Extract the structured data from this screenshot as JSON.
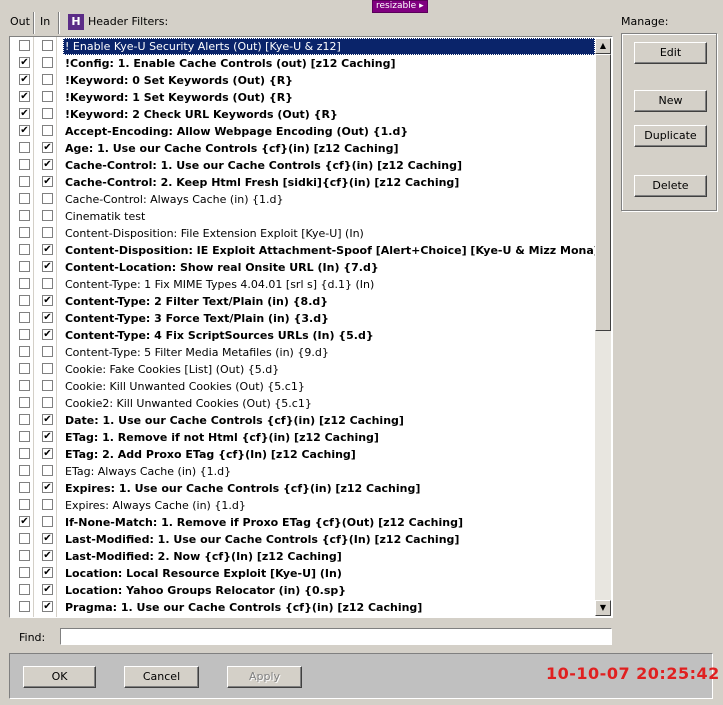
{
  "resizable_label": "resizable",
  "columns": {
    "out": "Out",
    "in": "In"
  },
  "header_icon": "H",
  "header_filters_label": "Header Filters:",
  "manage_label": "Manage:",
  "buttons": {
    "edit": "Edit",
    "new": "New",
    "duplicate": "Duplicate",
    "delete": "Delete"
  },
  "find_label": "Find:",
  "find_value": "",
  "dialog": {
    "ok": "OK",
    "cancel": "Cancel",
    "apply": "Apply"
  },
  "timestamp": "10-10-07 20:25:42",
  "colors": {
    "selection": "#0a246a",
    "timestamp": "#e02020",
    "badge": "#800080"
  },
  "filters": [
    {
      "out": false,
      "in": false,
      "bold": false,
      "selected": true,
      "label": "! Enable Kye-U Security Alerts (Out) [Kye-U & z12]"
    },
    {
      "out": true,
      "in": false,
      "bold": true,
      "label": "!Config: 1. Enable Cache Controls (out) [z12 Caching]"
    },
    {
      "out": true,
      "in": false,
      "bold": true,
      "label": "!Keyword: 0 Set Keywords (Out) {R}"
    },
    {
      "out": true,
      "in": false,
      "bold": true,
      "label": "!Keyword: 1 Set Keywords (Out) {R}"
    },
    {
      "out": true,
      "in": false,
      "bold": true,
      "label": "!Keyword: 2 Check URL Keywords (Out) {R}"
    },
    {
      "out": true,
      "in": false,
      "bold": true,
      "label": "Accept-Encoding: Allow Webpage Encoding (Out) {1.d}"
    },
    {
      "out": false,
      "in": true,
      "bold": true,
      "label": "Age: 1. Use our Cache Controls {cf}(in) [z12 Caching]"
    },
    {
      "out": false,
      "in": true,
      "bold": true,
      "label": "Cache-Control: 1. Use our Cache Controls {cf}(in) [z12 Caching]"
    },
    {
      "out": false,
      "in": true,
      "bold": true,
      "label": "Cache-Control: 2. Keep Html Fresh [sidki]{cf}(in) [z12 Caching]"
    },
    {
      "out": false,
      "in": false,
      "bold": false,
      "label": "Cache-Control: Always Cache (in) {1.d}"
    },
    {
      "out": false,
      "in": false,
      "bold": false,
      "label": "Cinematik test"
    },
    {
      "out": false,
      "in": false,
      "bold": false,
      "label": "Content-Disposition: File Extension Exploit [Kye-U] (In)"
    },
    {
      "out": false,
      "in": true,
      "bold": true,
      "label": "Content-Disposition: IE Exploit Attachment-Spoof [Alert+Choice] [Kye-U & Mizz Mona] (In)"
    },
    {
      "out": false,
      "in": true,
      "bold": true,
      "label": "Content-Location: Show real Onsite URL (In) {7.d}"
    },
    {
      "out": false,
      "in": false,
      "bold": false,
      "label": "Content-Type: 1 Fix MIME Types      4.04.01 [srl s] {d.1} (In)"
    },
    {
      "out": false,
      "in": true,
      "bold": true,
      "label": "Content-Type: 2 Filter Text/Plain (in) {8.d}"
    },
    {
      "out": false,
      "in": true,
      "bold": true,
      "label": "Content-Type: 3 Force Text/Plain (in) {3.d}"
    },
    {
      "out": false,
      "in": true,
      "bold": true,
      "label": "Content-Type: 4 Fix ScriptSources URLs (In) {5.d}"
    },
    {
      "out": false,
      "in": false,
      "bold": false,
      "label": "Content-Type: 5 Filter Media Metafiles (in) {9.d}"
    },
    {
      "out": false,
      "in": false,
      "bold": false,
      "label": "Cookie: Fake Cookies [List] (Out) {5.d}"
    },
    {
      "out": false,
      "in": false,
      "bold": false,
      "label": "Cookie: Kill Unwanted Cookies (Out)  {5.c1}"
    },
    {
      "out": false,
      "in": false,
      "bold": false,
      "label": "Cookie2: Kill Unwanted Cookies (Out)  {5.c1}"
    },
    {
      "out": false,
      "in": true,
      "bold": true,
      "label": "Date: 1. Use our Cache Controls {cf}(in) [z12 Caching]"
    },
    {
      "out": false,
      "in": true,
      "bold": true,
      "label": "ETag: 1. Remove if not Html {cf}(in) [z12 Caching]"
    },
    {
      "out": false,
      "in": true,
      "bold": true,
      "label": "ETag: 2. Add Proxo ETag {cf}(In) [z12 Caching]"
    },
    {
      "out": false,
      "in": false,
      "bold": false,
      "label": "ETag: Always Cache (in) {1.d}"
    },
    {
      "out": false,
      "in": true,
      "bold": true,
      "label": "Expires: 1. Use our Cache Controls {cf}(in) [z12 Caching]"
    },
    {
      "out": false,
      "in": false,
      "bold": false,
      "label": "Expires: Always Cache (in) {1.d}"
    },
    {
      "out": true,
      "in": false,
      "bold": true,
      "label": "If-None-Match: 1. Remove if Proxo ETag {cf}(Out) [z12 Caching]"
    },
    {
      "out": false,
      "in": true,
      "bold": true,
      "label": "Last-Modified: 1. Use our Cache Controls {cf}(In) [z12 Caching]"
    },
    {
      "out": false,
      "in": true,
      "bold": true,
      "label": "Last-Modified: 2. Now {cf}(In) [z12 Caching]"
    },
    {
      "out": false,
      "in": true,
      "bold": true,
      "label": "Location: Local Resource Exploit [Kye-U] (In)"
    },
    {
      "out": false,
      "in": true,
      "bold": true,
      "label": "Location: Yahoo Groups Relocator (in) {0.sp}"
    },
    {
      "out": false,
      "in": true,
      "bold": true,
      "label": "Pragma: 1. Use our Cache Controls {cf}(in) [z12 Caching]"
    }
  ]
}
